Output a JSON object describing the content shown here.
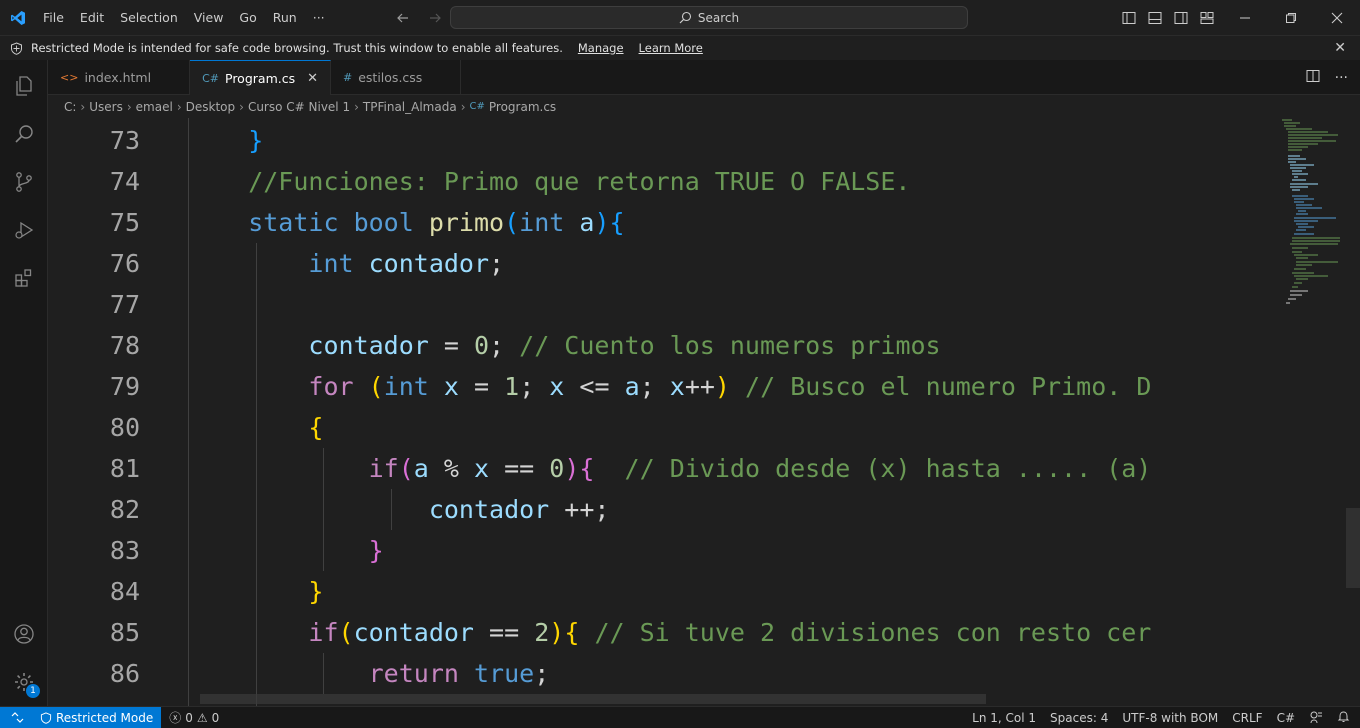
{
  "titlebar": {
    "menu": [
      "File",
      "Edit",
      "Selection",
      "View",
      "Go",
      "Run",
      "···"
    ],
    "search_placeholder": "Search"
  },
  "banner": {
    "message": "Restricted Mode is intended for safe code browsing. Trust this window to enable all features.",
    "manage": "Manage",
    "learn_more": "Learn More"
  },
  "tabs": [
    {
      "label": "index.html",
      "icon": "html-icon",
      "active": false
    },
    {
      "label": "Program.cs",
      "icon": "csharp-icon",
      "active": true
    },
    {
      "label": "estilos.css",
      "icon": "css-icon",
      "active": false
    }
  ],
  "breadcrumb": [
    "C:",
    "Users",
    "emael",
    "Desktop",
    "Curso C# Nivel 1",
    "TPFinal_Almada",
    "Program.cs"
  ],
  "editor": {
    "line_numbers": [
      "73",
      "74",
      "75",
      "76",
      "77",
      "78",
      "79",
      "80",
      "81",
      "82",
      "83",
      "84",
      "85",
      "86"
    ]
  },
  "statusbar": {
    "restricted_mode": "Restricted Mode",
    "errors": "0",
    "warnings": "0",
    "position": "Ln 1, Col 1",
    "spaces": "Spaces: 4",
    "encoding": "UTF-8 with BOM",
    "eol": "CRLF",
    "language": "C#",
    "notifications_badge": "1"
  },
  "colors": {
    "accent": "#0078d4",
    "editor_bg": "#1f1f1f",
    "comment": "#6a9955",
    "keyword": "#569cd6"
  }
}
